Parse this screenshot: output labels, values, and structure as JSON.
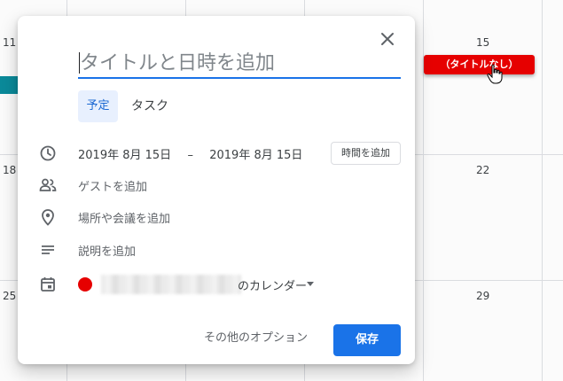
{
  "calendar": {
    "days": {
      "d11": "11",
      "d15": "15",
      "d18": "18",
      "d22": "22",
      "d25": "25",
      "d29": "29"
    },
    "pending_event_label": "（タイトルなし）",
    "pending_event_color": "#e60000",
    "other_event_color": "#0b8a9a"
  },
  "dialog": {
    "close_icon": "close-icon",
    "title_placeholder": "タイトルと日時を追加",
    "tabs": [
      {
        "label": "予定",
        "selected": true
      },
      {
        "label": "タスク",
        "selected": false
      }
    ],
    "date": {
      "start": "2019年 8月 15日",
      "separator": "–",
      "end": "2019年 8月 15日"
    },
    "add_time_label": "時間を追加",
    "guests_label": "ゲストを追加",
    "location_label": "場所や会議を追加",
    "description_label": "説明を追加",
    "calendar_owner_suffix": "のカレンダー",
    "calendar_color": "#e60000",
    "more_options_label": "その他のオプション",
    "save_label": "保存",
    "accent_color": "#1a73e8"
  }
}
